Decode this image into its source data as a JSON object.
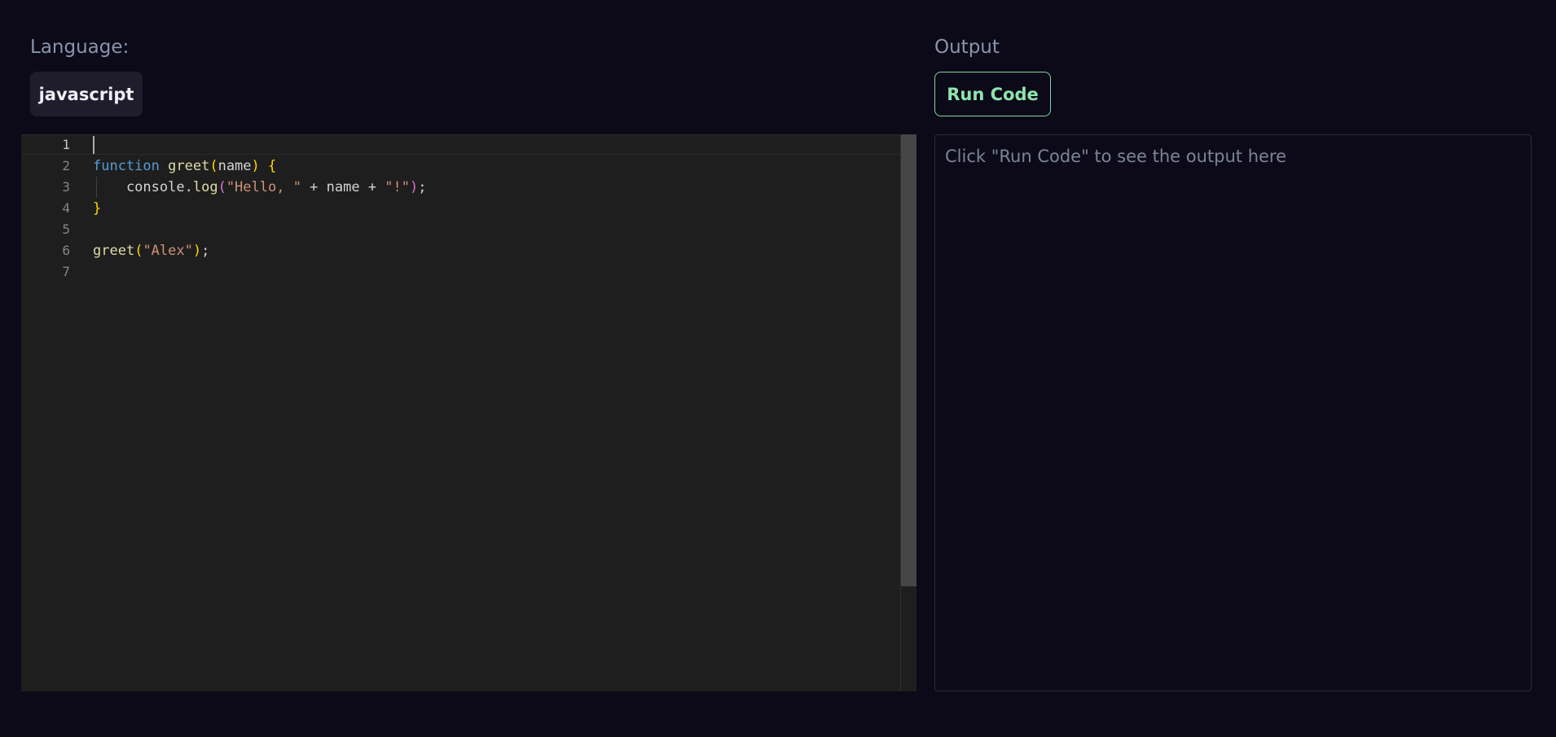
{
  "language_panel": {
    "label": "Language:",
    "selected_language": "javascript"
  },
  "output_panel": {
    "label": "Output",
    "run_button_label": "Run Code",
    "placeholder": "Click \"Run Code\" to see the output here"
  },
  "editor": {
    "line_numbers": [
      "1",
      "2",
      "3",
      "4",
      "5",
      "6",
      "7"
    ],
    "active_line": 1,
    "lines": [
      [],
      [
        [
          "kw",
          "function"
        ],
        [
          "id",
          " "
        ],
        [
          "fn",
          "greet"
        ],
        [
          "br1",
          "("
        ],
        [
          "id",
          "name"
        ],
        [
          "br1",
          ")"
        ],
        [
          "id",
          " "
        ],
        [
          "br1",
          "{"
        ]
      ],
      [
        [
          "id",
          "    console"
        ],
        [
          "punc",
          "."
        ],
        [
          "fn",
          "log"
        ],
        [
          "br2",
          "("
        ],
        [
          "str",
          "\"Hello, \""
        ],
        [
          "id",
          " + name + "
        ],
        [
          "str",
          "\"!\""
        ],
        [
          "br2",
          ")"
        ],
        [
          "punc",
          ";"
        ]
      ],
      [
        [
          "br1",
          "}"
        ]
      ],
      [],
      [
        [
          "fn",
          "greet"
        ],
        [
          "br1",
          "("
        ],
        [
          "str",
          "\"Alex\""
        ],
        [
          "br1",
          ")"
        ],
        [
          "punc",
          ";"
        ]
      ],
      []
    ]
  },
  "colors": {
    "background": "#0c0a18",
    "editor_background": "#1e1e1e",
    "run_button_accent": "#8fe3ae",
    "keyword": "#569cd6",
    "function": "#dcdcaa",
    "string": "#ce9178",
    "bracket_level1": "#ffd700",
    "bracket_level2": "#da70d6"
  }
}
